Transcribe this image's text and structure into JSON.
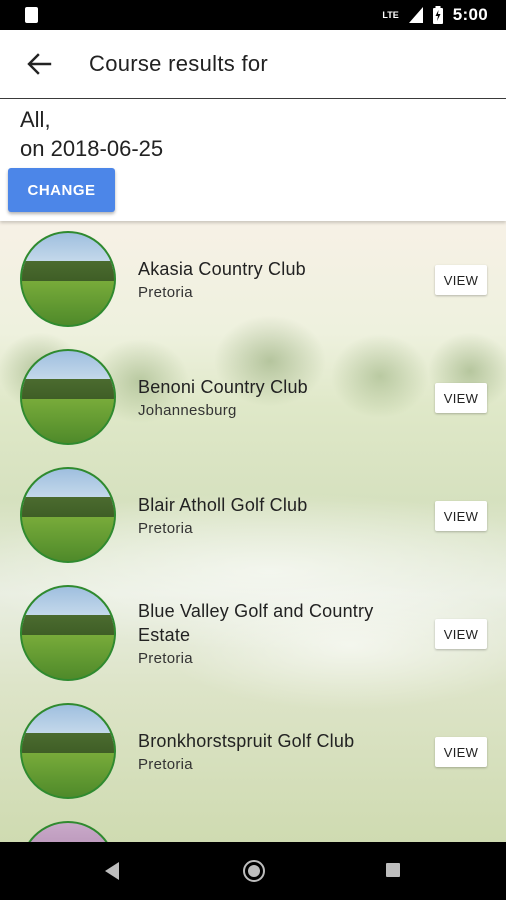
{
  "status_bar": {
    "network": "LTE",
    "time": "5:00"
  },
  "app_bar": {
    "title": "Course results for"
  },
  "summary": {
    "line1": "All,",
    "line2": "on 2018-06-25",
    "change_label": "CHANGE"
  },
  "courses": [
    {
      "name": "Akasia Country Club",
      "city": "Pretoria",
      "view_label": "VIEW"
    },
    {
      "name": "Benoni Country Club",
      "city": "Johannesburg",
      "view_label": "VIEW"
    },
    {
      "name": "Blair Atholl Golf Club",
      "city": "Pretoria",
      "view_label": "VIEW"
    },
    {
      "name": "Blue Valley Golf and Country Estate",
      "city": "Pretoria",
      "view_label": "VIEW"
    },
    {
      "name": "Bronkhorstspruit Golf Club",
      "city": "Pretoria",
      "view_label": "VIEW"
    }
  ]
}
